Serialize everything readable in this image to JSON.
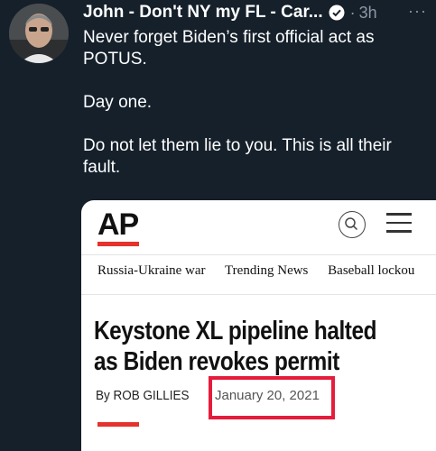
{
  "tweet": {
    "display_name": "John - Don't NY my FL - Car...",
    "separator": "·",
    "time": "3h",
    "more": "···",
    "paragraphs": [
      "Never forget Biden’s first official act as POTUS.",
      "Day one.",
      "Do not let them lie to you. This is all their fault."
    ]
  },
  "card": {
    "logo": "AP",
    "nav_items": [
      "Russia-Ukraine war",
      "Trending News",
      "Baseball lockou"
    ],
    "headline": "Keystone XL pipeline halted as Biden revokes permit",
    "byline": "By ROB GILLIES",
    "date": "January 20, 2021",
    "accent_color": "#e5322c",
    "highlight_color": "#e51c3c"
  },
  "icons": {
    "verified": "verified-badge-icon",
    "search": "search-icon",
    "menu": "hamburger-menu-icon",
    "more": "more-options-icon"
  }
}
